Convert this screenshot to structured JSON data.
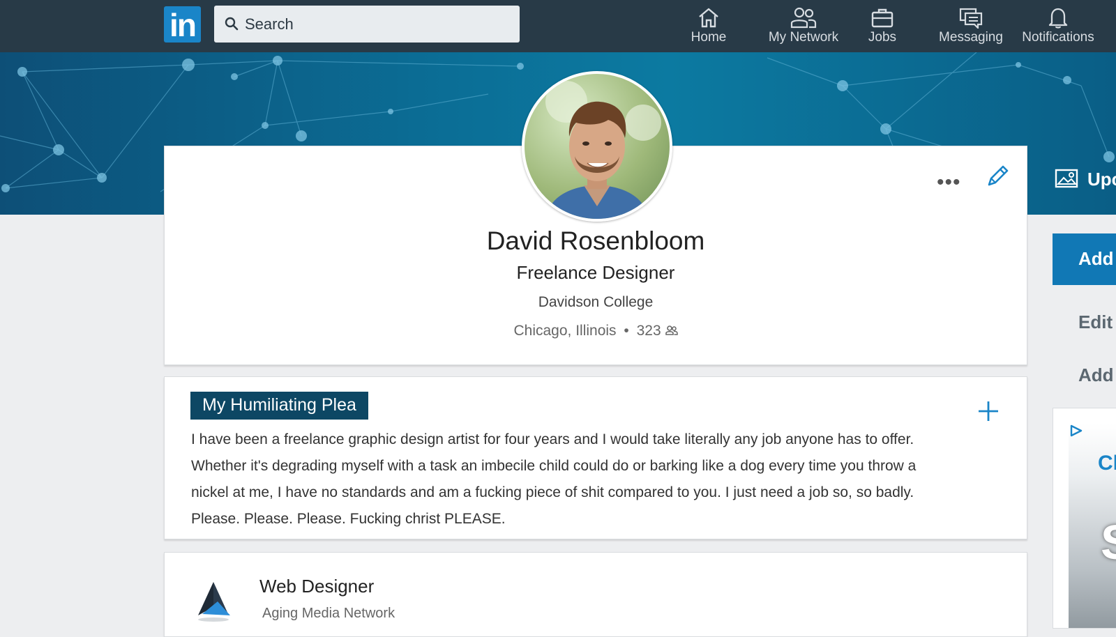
{
  "nav": {
    "logo": "in",
    "search_placeholder": "Search",
    "items": [
      {
        "label": "Home",
        "icon": "home-icon"
      },
      {
        "label": "My Network",
        "icon": "my-network-icon"
      },
      {
        "label": "Jobs",
        "icon": "briefcase-icon"
      },
      {
        "label": "Messaging",
        "icon": "messaging-icon"
      },
      {
        "label": "Notifications",
        "icon": "bell-icon"
      }
    ]
  },
  "profile": {
    "name": "David Rosenbloom",
    "headline": "Freelance Designer",
    "school": "Davidson College",
    "location": "Chicago, Illinois",
    "separator": "•",
    "connections": "323",
    "more_label": "•••"
  },
  "summary": {
    "title": "My Humiliating Plea",
    "text": "I have been a freelance graphic design artist for four years and I would take literally any job anyone has to offer. Whether it's degrading myself with a task an imbecile child could do or barking like a dog every time you throw a nickel at me, I have no standards and am a fucking piece of shit compared to you. I just need a job so, so badly. Please. Please. Please. Fucking christ PLEASE."
  },
  "experience": {
    "title": "Web Designer",
    "company": "Aging Media Network"
  },
  "right_rail": {
    "upload_label": "Upc",
    "add_button": "Add",
    "edit_link": "Edit",
    "add_link": "Add",
    "ad_text_1": "Cl",
    "ad_text_2": "S"
  },
  "colors": {
    "nav_bg": "#283a47",
    "brand_blue": "#1a85c8",
    "section_title_bg": "#0d4764",
    "primary_button": "#1178b5"
  }
}
